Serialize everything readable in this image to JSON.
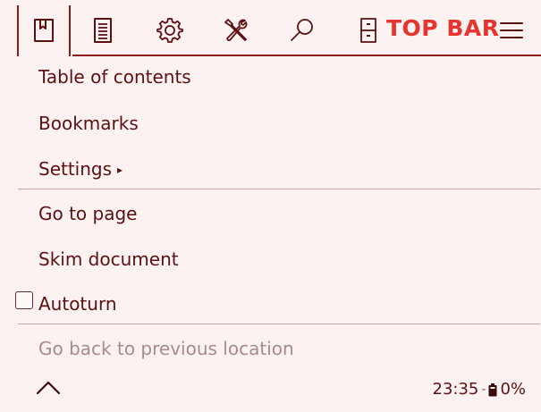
{
  "topbar": {
    "label": "TOP BAR",
    "tabs": [
      {
        "name": "bookmark-tab",
        "icon": "bookmark-icon",
        "active": true
      },
      {
        "name": "document-tab",
        "icon": "document-icon",
        "active": false
      },
      {
        "name": "settings-tab",
        "icon": "gear-icon",
        "active": false
      },
      {
        "name": "tools-tab",
        "icon": "tools-icon",
        "active": false
      },
      {
        "name": "search-tab",
        "icon": "search-icon",
        "active": false
      },
      {
        "name": "filemanager-tab",
        "icon": "filing-cabinet-icon",
        "active": false
      },
      {
        "name": "main-menu-tab",
        "icon": "hamburger-menu-icon",
        "active": false
      }
    ]
  },
  "menu": {
    "items": [
      {
        "label": "Table of contents",
        "enabled": true
      },
      {
        "label": "Bookmarks",
        "enabled": true
      },
      {
        "label": "Settings",
        "submenu_arrow": "▸",
        "enabled": true
      },
      {
        "label": "Go to page",
        "enabled": true
      },
      {
        "label": "Skim document",
        "enabled": true
      },
      {
        "label": "Autoturn",
        "checkbox": true,
        "checked": false,
        "enabled": true
      },
      {
        "label": "Go back to previous location",
        "enabled": false
      }
    ]
  },
  "footer": {
    "chevron_icon": "chevron-up-icon",
    "time": "23:35",
    "separator": "-",
    "battery_icon": "battery-icon",
    "battery": "0%"
  },
  "colors": {
    "background": "#fcf2f2",
    "text": "#5c1010",
    "accent": "#e6342f",
    "border": "#8b1a1a",
    "disabled": "#a98a8a"
  }
}
